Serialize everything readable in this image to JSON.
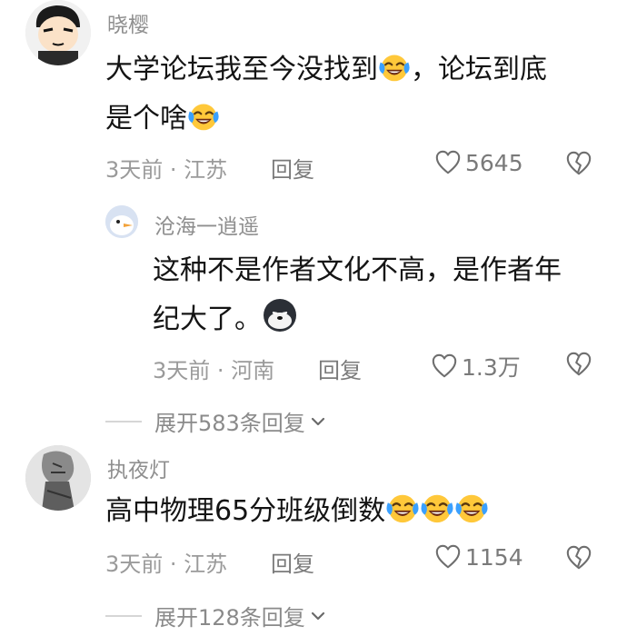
{
  "comments": [
    {
      "user": "晓樱",
      "text1": "大学论坛我至今没找到",
      "text1b": "，论坛到底",
      "text2": "是个啥",
      "time_loc": "3天前 · 江苏",
      "reply_label": "回复",
      "likes": "5645",
      "reply": {
        "user": "沧海一逍遥",
        "text1": "这种不是作者文化不高，是作者年",
        "text2": "纪大了。",
        "time_loc": "3天前 · 河南",
        "reply_label": "回复",
        "likes": "1.3万"
      },
      "expand_label": "展开583条回复"
    },
    {
      "user": "执夜灯",
      "text1": "高中物理65分班级倒数",
      "time_loc": "3天前 · 江苏",
      "reply_label": "回复",
      "likes": "1154",
      "expand_label": "展开128条回复"
    }
  ],
  "icons": {
    "like": "heart-outline-icon",
    "dislike": "broken-heart-icon",
    "expand": "chevron-down-icon",
    "emoji_laugh": "laughing-crying-emoji",
    "emoji_dog": "doge-emoji"
  }
}
